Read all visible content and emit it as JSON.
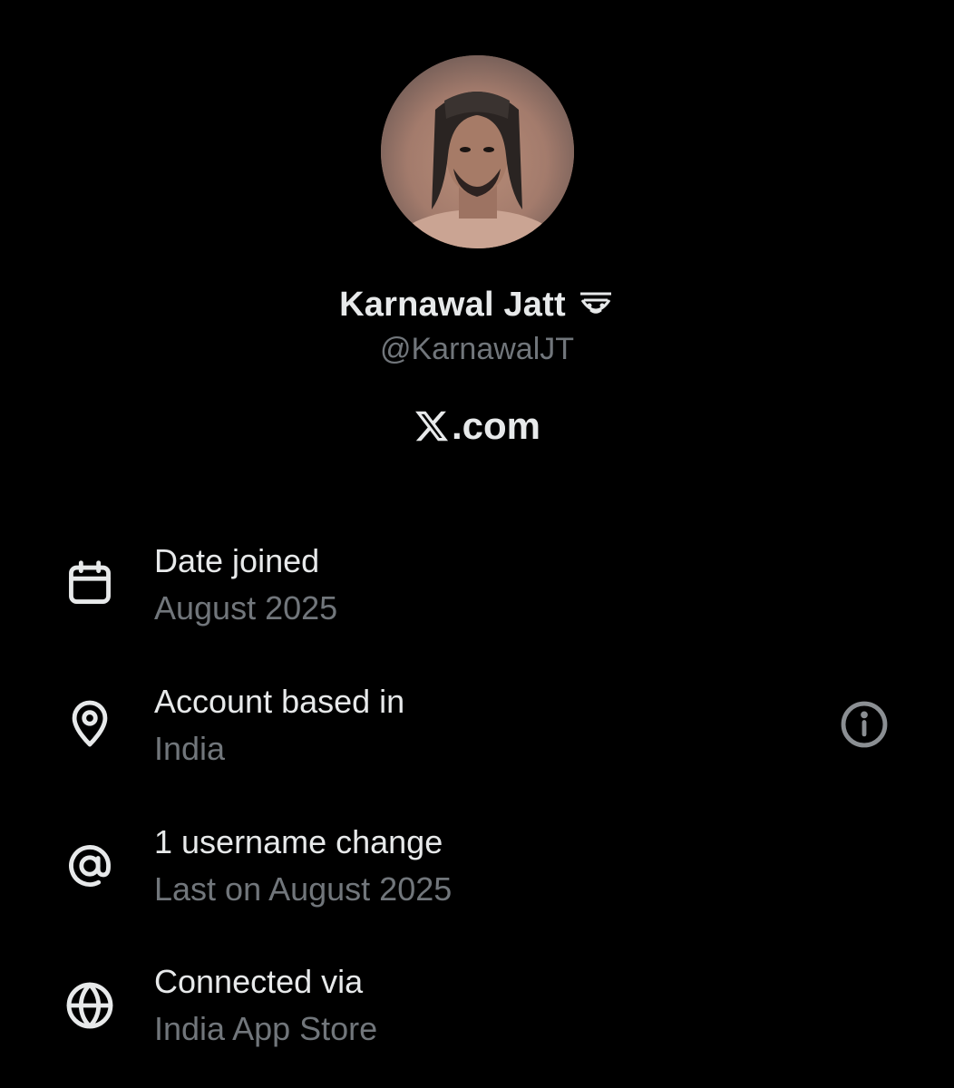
{
  "profile": {
    "display_name": "Karnawal Jatt",
    "handle": "@KarnawalJT",
    "badge_icon": "emoji-face-badge-icon",
    "avatar": "profile-avatar-photo"
  },
  "brand": {
    "logo_icon": "x-logo-icon",
    "domain_text": ".com"
  },
  "about": {
    "rows": [
      {
        "icon": "calendar-icon",
        "title": "Date joined",
        "value": "August 2025"
      },
      {
        "icon": "location-pin-icon",
        "title": "Account based in",
        "value": "India",
        "action_icon": "info-icon"
      },
      {
        "icon": "at-sign-icon",
        "title": "1 username change",
        "value": "Last on August 2025"
      },
      {
        "icon": "globe-icon",
        "title": "Connected via",
        "value": "India App Store"
      }
    ]
  },
  "colors": {
    "background": "#000000",
    "primary_text": "#e7e9ea",
    "secondary_text": "#71767b"
  }
}
